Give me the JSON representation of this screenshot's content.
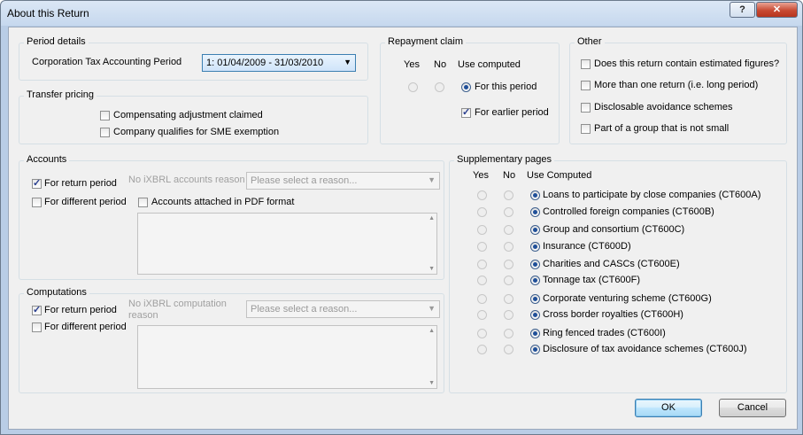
{
  "window": {
    "title": "About this Return",
    "help_label": "?",
    "close_label": "✕"
  },
  "period_details": {
    "legend": "Period details",
    "label": "Corporation Tax Accounting Period",
    "selected": "1: 01/04/2009 - 31/03/2010"
  },
  "transfer_pricing": {
    "legend": "Transfer pricing",
    "items": [
      {
        "label": "Compensating adjustment claimed",
        "checked": false
      },
      {
        "label": "Company qualifies for SME exemption",
        "checked": false
      }
    ]
  },
  "repayment_claim": {
    "legend": "Repayment claim",
    "headers": {
      "yes": "Yes",
      "no": "No",
      "use": "Use computed"
    },
    "for_this_period": "For this period",
    "for_earlier_period": "For earlier period"
  },
  "other": {
    "legend": "Other",
    "items": [
      {
        "label": "Does this return contain estimated figures?",
        "checked": false
      },
      {
        "label": "More than one return (i.e. long period)",
        "checked": false
      },
      {
        "label": "Disclosable avoidance schemes",
        "checked": false
      },
      {
        "label": "Part of a group that is not small",
        "checked": false
      }
    ]
  },
  "accounts": {
    "legend": "Accounts",
    "for_return_period": "For return period",
    "for_different_period": "For different period",
    "no_ixbrl_label": "No iXBRL accounts reason",
    "placeholder": "Please select a reason...",
    "pdf_label": "Accounts attached in PDF format"
  },
  "computations": {
    "legend": "Computations",
    "for_return_period": "For return period",
    "for_different_period": "For different period",
    "no_ixbrl_label_1": "No iXBRL computation",
    "no_ixbrl_label_2": "reason",
    "placeholder": "Please select a reason..."
  },
  "supplementary": {
    "legend": "Supplementary pages",
    "headers": {
      "yes": "Yes",
      "no": "No",
      "use": "Use Computed"
    },
    "pages": [
      "Loans to participate by close companies (CT600A)",
      "Controlled foreign companies (CT600B)",
      "Group and consortium (CT600C)",
      "Insurance (CT600D)",
      "Charities and CASCs (CT600E)",
      "Tonnage tax (CT600F)",
      "Corporate venturing scheme (CT600G)",
      "Cross border royalties (CT600H)",
      "Ring fenced trades (CT600I)",
      "Disclosure of tax avoidance schemes (CT600J)"
    ]
  },
  "buttons": {
    "ok": "OK",
    "cancel": "Cancel"
  },
  "colors": {
    "title_bar": "#c6d8ee",
    "close_button": "#c84a33",
    "default_button": "#bee6fd"
  }
}
